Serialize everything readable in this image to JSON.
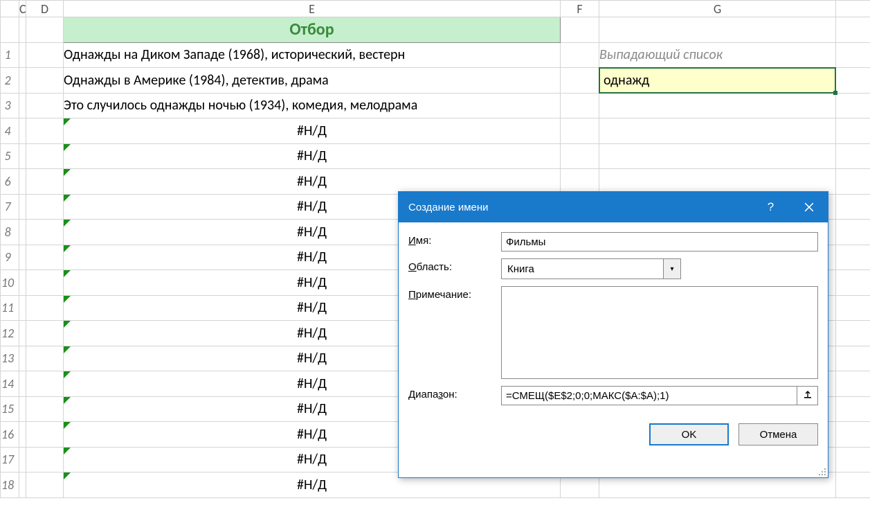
{
  "columns": {
    "C": "C",
    "D": "D",
    "E": "E",
    "F": "F",
    "G": "G"
  },
  "header_E": "Отбор",
  "rows": [
    {
      "n": "1",
      "e": "Однажды на Диком Западе (1968), исторический, вестерн",
      "err": false,
      "align": "left"
    },
    {
      "n": "2",
      "e": "Однажды в Америке (1984), детектив, драма",
      "err": false,
      "align": "left"
    },
    {
      "n": "3",
      "e": "Это случилось однажды ночью (1934), комедия, мелодрама",
      "err": false,
      "align": "left"
    },
    {
      "n": "4",
      "e": "#Н/Д",
      "err": true,
      "align": "center"
    },
    {
      "n": "5",
      "e": "#Н/Д",
      "err": true,
      "align": "center"
    },
    {
      "n": "6",
      "e": "#Н/Д",
      "err": true,
      "align": "center"
    },
    {
      "n": "7",
      "e": "#Н/Д",
      "err": true,
      "align": "center"
    },
    {
      "n": "8",
      "e": "#Н/Д",
      "err": true,
      "align": "center"
    },
    {
      "n": "9",
      "e": "#Н/Д",
      "err": true,
      "align": "center"
    },
    {
      "n": "10",
      "e": "#Н/Д",
      "err": true,
      "align": "center"
    },
    {
      "n": "11",
      "e": "#Н/Д",
      "err": true,
      "align": "center"
    },
    {
      "n": "12",
      "e": "#Н/Д",
      "err": true,
      "align": "center"
    },
    {
      "n": "13",
      "e": "#Н/Д",
      "err": true,
      "align": "center"
    },
    {
      "n": "14",
      "e": "#Н/Д",
      "err": true,
      "align": "center"
    },
    {
      "n": "15",
      "e": "#Н/Д",
      "err": true,
      "align": "center"
    },
    {
      "n": "16",
      "e": "#Н/Д",
      "err": true,
      "align": "center"
    },
    {
      "n": "17",
      "e": "#Н/Д",
      "err": true,
      "align": "center"
    },
    {
      "n": "18",
      "e": "#Н/Д",
      "err": true,
      "align": "center"
    }
  ],
  "g_title": "Выпадающий список",
  "g_value": "однажд",
  "dialog": {
    "title": "Создание имени",
    "name_label": "Имя:",
    "name_underline": "И",
    "name_rest": "мя:",
    "name_value": "Фильмы",
    "scope_label": "Область:",
    "scope_underline": "О",
    "scope_rest": "бласть:",
    "scope_value": "Книга",
    "comment_label": "Примечание:",
    "comment_underline": "П",
    "comment_rest": "римечание:",
    "comment_value": "",
    "range_label": "Диапазон:",
    "range_underline": "з",
    "range_pre": "Диапа",
    "range_post": "он:",
    "range_value": "=СМЕЩ($E$2;0;0;МАКС($A:$A);1)",
    "ok": "OK",
    "cancel": "Отмена"
  }
}
